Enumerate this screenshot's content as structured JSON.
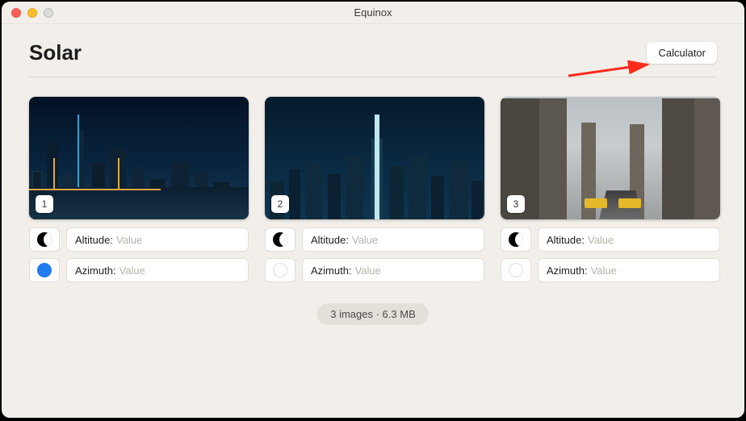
{
  "window": {
    "title": "Equinox"
  },
  "header": {
    "title": "Solar",
    "calculator_label": "Calculator"
  },
  "cards": [
    {
      "index": "1",
      "altitude_label": "Altitude:",
      "altitude_value": "Value",
      "azimuth_label": "Azimuth:",
      "azimuth_value": "Value",
      "primary_selected": true
    },
    {
      "index": "2",
      "altitude_label": "Altitude:",
      "altitude_value": "Value",
      "azimuth_label": "Azimuth:",
      "azimuth_value": "Value",
      "primary_selected": false
    },
    {
      "index": "3",
      "altitude_label": "Altitude:",
      "altitude_value": "Value",
      "azimuth_label": "Azimuth:",
      "azimuth_value": "Value",
      "primary_selected": false
    }
  ],
  "status": {
    "text": "3 images · 6.3 MB"
  }
}
